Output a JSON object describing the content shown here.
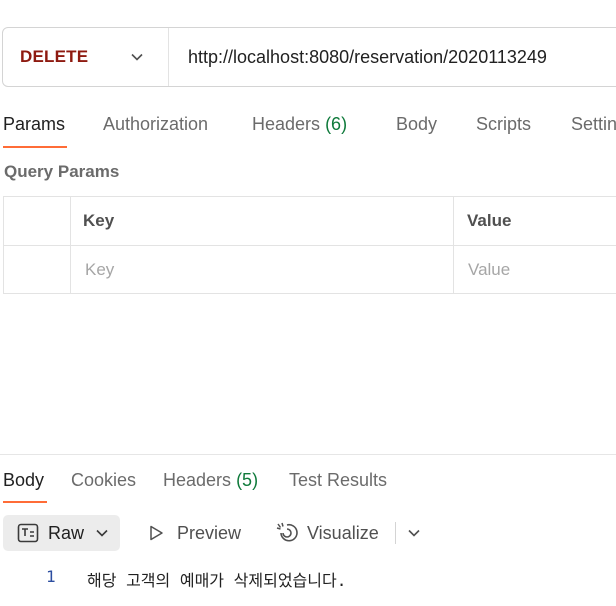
{
  "request": {
    "method": "DELETE",
    "url": "http://localhost:8080/reservation/2020113249"
  },
  "request_tabs": [
    {
      "label": "Params"
    },
    {
      "label": "Authorization"
    },
    {
      "label": "Headers",
      "count": "(6)"
    },
    {
      "label": "Body"
    },
    {
      "label": "Scripts"
    },
    {
      "label": "Settings"
    }
  ],
  "query_params": {
    "title": "Query Params",
    "col_key": "Key",
    "col_value": "Value",
    "key_placeholder": "Key",
    "value_placeholder": "Value"
  },
  "response_tabs": [
    {
      "label": "Body"
    },
    {
      "label": "Cookies"
    },
    {
      "label": "Headers",
      "count": "(5)"
    },
    {
      "label": "Test Results"
    }
  ],
  "format_bar": {
    "raw_label": "Raw",
    "preview_label": "Preview",
    "visualize_label": "Visualize"
  },
  "response_body": {
    "line_number": "1",
    "line_text": "해당 고객의 예매가 삭제되었습니다."
  },
  "colors": {
    "method": "#8e1a10",
    "accent": "#ff6c37",
    "count": "#0f7a3b",
    "line_number": "#2c4ea0"
  }
}
